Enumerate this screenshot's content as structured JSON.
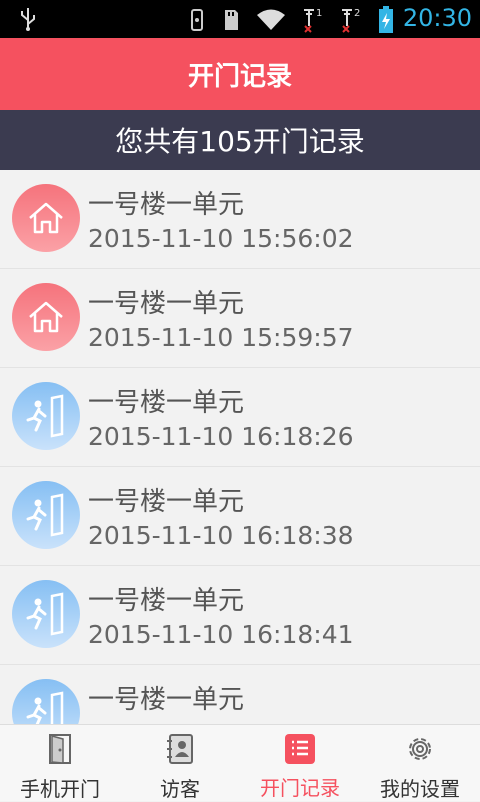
{
  "status_bar": {
    "time": "20:30",
    "sim1": "1",
    "sim2": "2"
  },
  "header": {
    "title": "开门记录"
  },
  "summary": {
    "text": "您共有105开门记录"
  },
  "records": [
    {
      "type": "home-icon",
      "location": "一号楼一单元",
      "time": "2015-11-10 15:56:02"
    },
    {
      "type": "home-icon",
      "location": "一号楼一单元",
      "time": "2015-11-10 15:59:57"
    },
    {
      "type": "door-icon",
      "location": "一号楼一单元",
      "time": "2015-11-10 16:18:26"
    },
    {
      "type": "door-icon",
      "location": "一号楼一单元",
      "time": "2015-11-10 16:18:38"
    },
    {
      "type": "door-icon",
      "location": "一号楼一单元",
      "time": "2015-11-10 16:18:41"
    },
    {
      "type": "door-icon",
      "location": "一号楼一单元",
      "time": ""
    }
  ],
  "tabs": [
    {
      "label": "手机开门",
      "icon": "door-icon",
      "active": false
    },
    {
      "label": "访客",
      "icon": "contacts-icon",
      "active": false
    },
    {
      "label": "开门记录",
      "icon": "list-icon",
      "active": true
    },
    {
      "label": "我的设置",
      "icon": "gear-icon",
      "active": false
    }
  ],
  "colors": {
    "accent": "#f5515f",
    "summary_bg": "#3b3b50",
    "time": "#33b5e5"
  }
}
